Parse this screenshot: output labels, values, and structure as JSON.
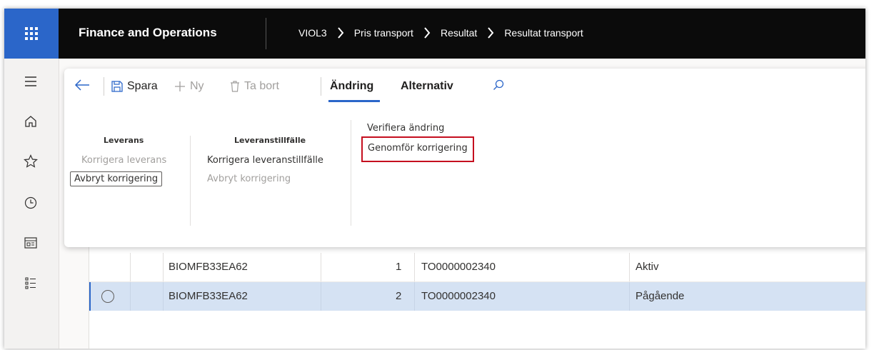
{
  "topbar": {
    "app_title": "Finance and Operations",
    "breadcrumb": [
      "VIOL3",
      "Pris transport",
      "Resultat",
      "Resultat transport"
    ]
  },
  "leftnav": {
    "icons": [
      "menu-icon",
      "home-icon",
      "star-icon",
      "clock-icon",
      "workspace-icon",
      "list-icon"
    ]
  },
  "toolbar": {
    "save_label": "Spara",
    "new_label": "Ny",
    "delete_label": "Ta bort",
    "tabs": [
      "Ändring",
      "Alternativ"
    ],
    "active_tab": "Ändring"
  },
  "action_groups": {
    "leverans": {
      "title": "Leverans",
      "items": [
        "Korrigera leverans",
        "Avbryt korrigering"
      ]
    },
    "leveranstillfalle": {
      "title": "Leveranstillfälle",
      "items": [
        "Korrigera leveranstillfälle",
        "Avbryt korrigering"
      ]
    },
    "verify": {
      "items": [
        "Verifiera ändring",
        "Genomför korrigering"
      ]
    }
  },
  "grid": {
    "rows": [
      {
        "code": "BIOMFB33EA62",
        "line": "1",
        "order": "TO0000002340",
        "status": "Aktiv",
        "selected": false
      },
      {
        "code": "BIOMFB33EA62",
        "line": "2",
        "order": "TO0000002340",
        "status": "Pågående",
        "selected": true
      }
    ]
  },
  "colors": {
    "accent": "#2b66c9",
    "highlight_border": "#c50f1f",
    "topbar_bg": "#0b0b0b",
    "selected_row_bg": "#d5e2f3"
  }
}
